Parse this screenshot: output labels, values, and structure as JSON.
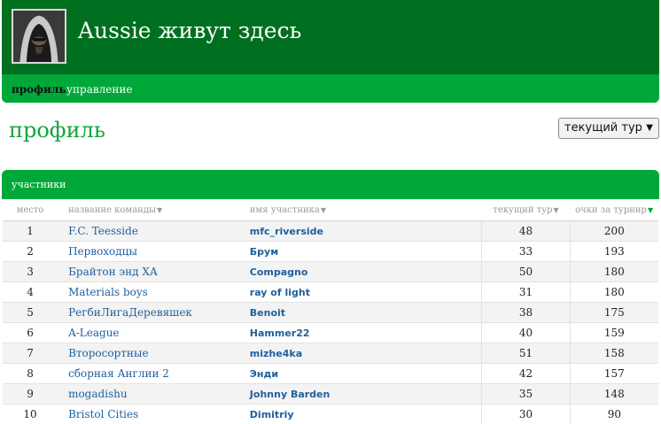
{
  "header": {
    "title": "Aussie живут здесь",
    "avatar": "hooded-assassin-avatar"
  },
  "nav": [
    {
      "label": "профиль",
      "active": true
    },
    {
      "label": "управление",
      "active": false
    }
  ],
  "page": {
    "title": "профиль",
    "round_select": {
      "selected": "текущий тур",
      "icon": "chevron-down-icon"
    }
  },
  "panel": {
    "title": "участники"
  },
  "table": {
    "columns": [
      "место",
      "название команды",
      "имя участника",
      "текущий тур",
      "очки за турнир"
    ],
    "sorted_column": "очки за турнир",
    "rows": [
      {
        "rank": "1",
        "team": "F.C. Teesside",
        "manager": "mfc_riverside",
        "round": "48",
        "total": "200"
      },
      {
        "rank": "2",
        "team": "Первоходцы",
        "manager": "Брум",
        "round": "33",
        "total": "193"
      },
      {
        "rank": "3",
        "team": "Брайтон энд ХА",
        "manager": "Compagno",
        "round": "50",
        "total": "180"
      },
      {
        "rank": "4",
        "team": "Materials boys",
        "manager": "ray of light",
        "round": "31",
        "total": "180"
      },
      {
        "rank": "5",
        "team": "РегбиЛигаДеревяшек",
        "manager": "Benoit",
        "round": "38",
        "total": "175"
      },
      {
        "rank": "6",
        "team": "A-League",
        "manager": "Hammer22",
        "round": "40",
        "total": "159"
      },
      {
        "rank": "7",
        "team": "Второсортные",
        "manager": "mizhe4ka",
        "round": "51",
        "total": "158"
      },
      {
        "rank": "8",
        "team": "сборная Англии 2",
        "manager": "Энди",
        "round": "42",
        "total": "157"
      },
      {
        "rank": "9",
        "team": "mogadishu",
        "manager": "Johnny Barden",
        "round": "35",
        "total": "148"
      },
      {
        "rank": "10",
        "team": "Bristol Cities",
        "manager": "Dimitriy",
        "round": "30",
        "total": "90"
      }
    ]
  },
  "colors": {
    "header_dark": "#006f1f",
    "header_green": "#00a83a",
    "title_green": "#12a53c",
    "link_blue": "#1f5f9c"
  }
}
